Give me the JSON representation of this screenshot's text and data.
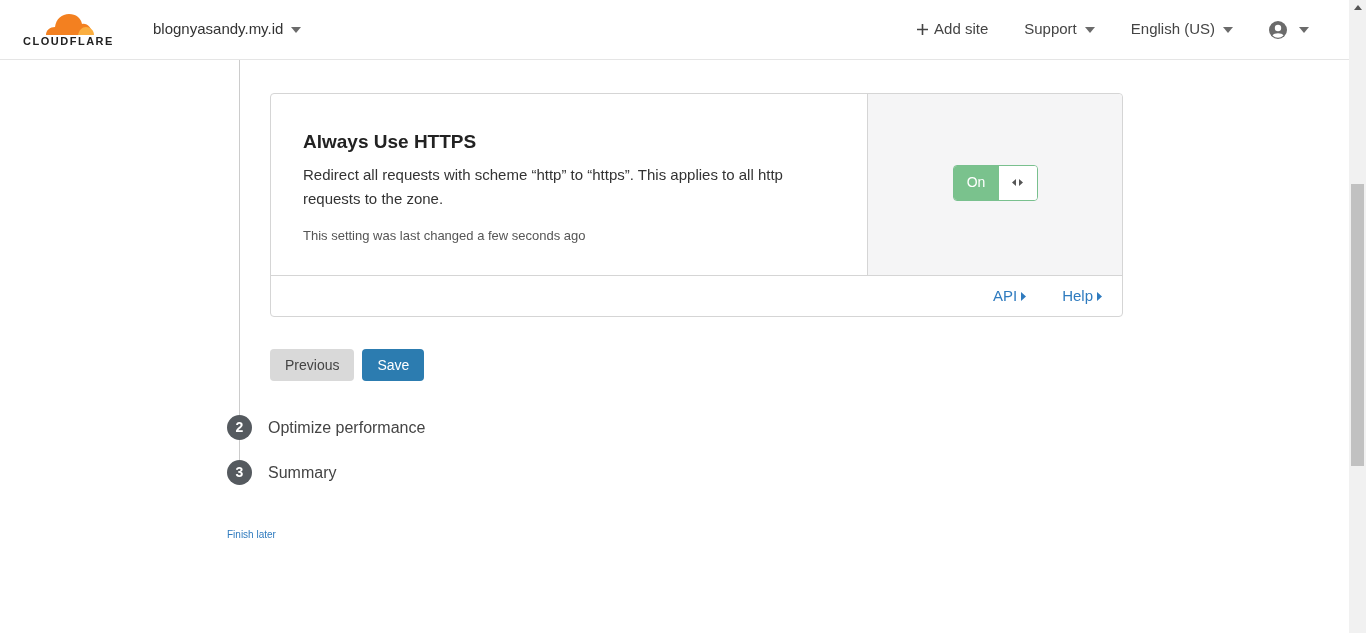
{
  "header": {
    "logo": "CLOUDFLARE",
    "site": "blognyasandy.my.id",
    "nav": [
      {
        "kind": "add",
        "label": "Add site"
      },
      {
        "kind": "menu",
        "label": "Support"
      },
      {
        "kind": "menu",
        "label": "English (US)"
      },
      {
        "kind": "account"
      }
    ]
  },
  "setting": {
    "title": "Always Use HTTPS",
    "description": "Redirect all requests with scheme “http” to “https”. This applies to all http requests to the zone.",
    "changed": "This setting was last changed a few seconds ago",
    "toggle": {
      "label": "On",
      "on": true
    },
    "links": [
      "API",
      "Help"
    ]
  },
  "actions": [
    {
      "kind": "secondary",
      "label": "Previous"
    },
    {
      "kind": "primary",
      "label": "Save"
    }
  ],
  "steps": [
    {
      "number": "2",
      "label": "Optimize performance"
    },
    {
      "number": "3",
      "label": "Summary"
    }
  ],
  "finish_later": "Finish later"
}
